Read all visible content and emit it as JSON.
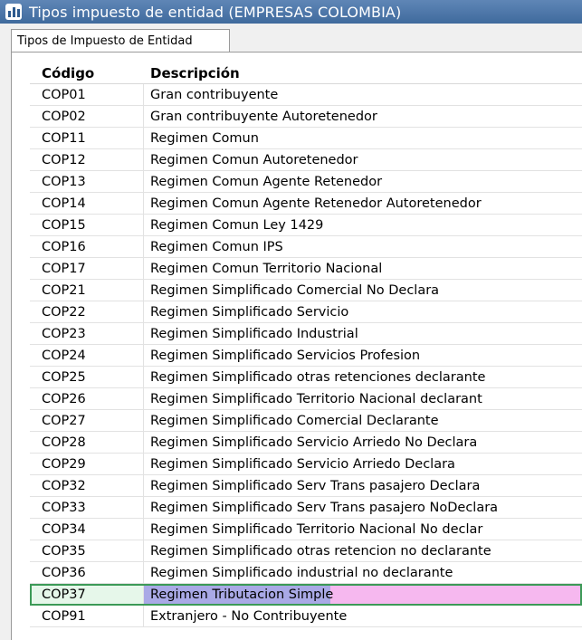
{
  "window": {
    "title": "Tipos impuesto de entidad (EMPRESAS COLOMBIA)"
  },
  "tab": {
    "label": "Tipos de Impuesto de Entidad"
  },
  "grid": {
    "columns": [
      "Código",
      "Descripción"
    ],
    "rows": [
      {
        "code": "COP01",
        "desc": "Gran contribuyente"
      },
      {
        "code": "COP02",
        "desc": "Gran contribuyente Autoretenedor"
      },
      {
        "code": "COP11",
        "desc": "Regimen Comun"
      },
      {
        "code": "COP12",
        "desc": "Regimen Comun Autoretenedor"
      },
      {
        "code": "COP13",
        "desc": "Regimen Comun Agente Retenedor"
      },
      {
        "code": "COP14",
        "desc": "Regimen Comun Agente Retenedor Autoretenedor"
      },
      {
        "code": "COP15",
        "desc": "Regimen Comun Ley 1429"
      },
      {
        "code": "COP16",
        "desc": "Regimen Comun IPS"
      },
      {
        "code": "COP17",
        "desc": "Regimen Comun Territorio Nacional"
      },
      {
        "code": "COP21",
        "desc": "Regimen Simplificado Comercial No Declara"
      },
      {
        "code": "COP22",
        "desc": "Regimen Simplificado Servicio"
      },
      {
        "code": "COP23",
        "desc": "Regimen Simplificado Industrial"
      },
      {
        "code": "COP24",
        "desc": "Regimen Simplificado Servicios Profesion"
      },
      {
        "code": "COP25",
        "desc": "Regimen Simplificado otras retenciones declarante"
      },
      {
        "code": "COP26",
        "desc": "Regimen Simplificado Territorio Nacional declarant"
      },
      {
        "code": "COP27",
        "desc": "Regimen Simplificado Comercial Declarante"
      },
      {
        "code": "COP28",
        "desc": "Regimen Simplificado Servicio Arriedo No Declara"
      },
      {
        "code": "COP29",
        "desc": "Regimen Simplificado Servicio Arriedo Declara"
      },
      {
        "code": "COP32",
        "desc": "Regimen Simplificado Serv Trans pasajero Declara"
      },
      {
        "code": "COP33",
        "desc": "Regimen Simplificado Serv Trans pasajero NoDeclara"
      },
      {
        "code": "COP34",
        "desc": "Regimen Simplificado Territorio Nacional No declar"
      },
      {
        "code": "COP35",
        "desc": "Regimen Simplificado otras retencion no declarante"
      },
      {
        "code": "COP36",
        "desc": "Regimen Simplificado industrial no declarante"
      },
      {
        "code": "COP37",
        "desc": "Regimen Tributacion Simple",
        "selected": true
      },
      {
        "code": "COP91",
        "desc": "Extranjero - No Contribuyente"
      }
    ]
  }
}
